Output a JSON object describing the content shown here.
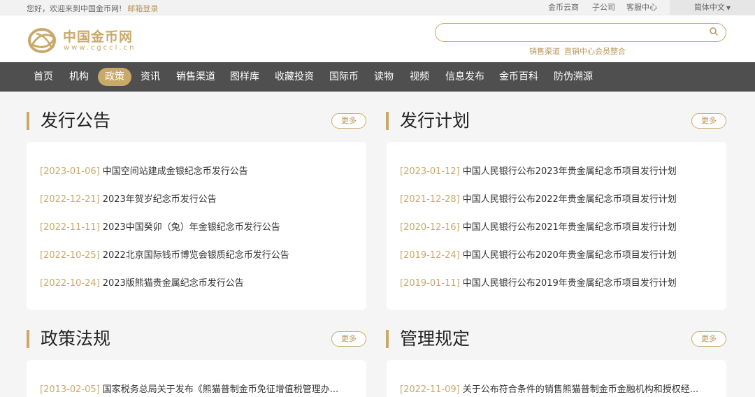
{
  "topbar": {
    "greeting": "您好，欢迎来到中国金币网!",
    "mail_login": "邮箱登录",
    "links": [
      "金币云商",
      "子公司",
      "客服中心"
    ],
    "language": "简体中文"
  },
  "header": {
    "logo_name": "中国金币网",
    "logo_url": "www.cgccl.cn",
    "search_placeholder": "",
    "hotlinks": [
      "销售渠道",
      "直销中心会员整合"
    ]
  },
  "nav": {
    "items": [
      "首页",
      "机构",
      "政策",
      "资讯",
      "销售渠道",
      "图样库",
      "收藏投资",
      "国际币",
      "读物",
      "视频",
      "信息发布",
      "金币百科",
      "防伪溯源"
    ],
    "active": "政策"
  },
  "sections": [
    {
      "title": "发行公告",
      "more": "更多",
      "items": [
        {
          "date": "[2023-01-06]",
          "text": "中国空间站建成金银纪念币发行公告"
        },
        {
          "date": "[2022-12-21]",
          "text": "2023年贺岁纪念币发行公告"
        },
        {
          "date": "[2022-11-11]",
          "text": "2023中国癸卯（兔）年金银纪念币发行公告"
        },
        {
          "date": "[2022-10-25]",
          "text": "2022北京国际钱币博览会银质纪念币发行公告"
        },
        {
          "date": "[2022-10-24]",
          "text": "2023版熊猫贵金属纪念币发行公告"
        }
      ]
    },
    {
      "title": "发行计划",
      "more": "更多",
      "items": [
        {
          "date": "[2023-01-12]",
          "text": "中国人民银行公布2023年贵金属纪念币项目发行计划"
        },
        {
          "date": "[2021-12-28]",
          "text": "中国人民银行公布2022年贵金属纪念币项目发行计划"
        },
        {
          "date": "[2020-12-16]",
          "text": "中国人民银行公布2021年贵金属纪念币项目发行计划"
        },
        {
          "date": "[2019-12-24]",
          "text": "中国人民银行公布2020年贵金属纪念币项目发行计划"
        },
        {
          "date": "[2019-01-11]",
          "text": "中国人民银行公布2019年贵金属纪念币项目发行计划"
        }
      ]
    },
    {
      "title": "政策法规",
      "more": "更多",
      "items": [
        {
          "date": "[2013-02-05]",
          "text": "国家税务总局关于发布《熊猫普制金币免征增值税管理办..."
        }
      ]
    },
    {
      "title": "管理规定",
      "more": "更多",
      "items": [
        {
          "date": "[2022-11-09]",
          "text": "关于公布符合条件的销售熊猫普制金币金融机构和授权经..."
        }
      ]
    }
  ],
  "colors": {
    "accent": "#c9a96a",
    "nav_bg": "#4f4f4f"
  }
}
